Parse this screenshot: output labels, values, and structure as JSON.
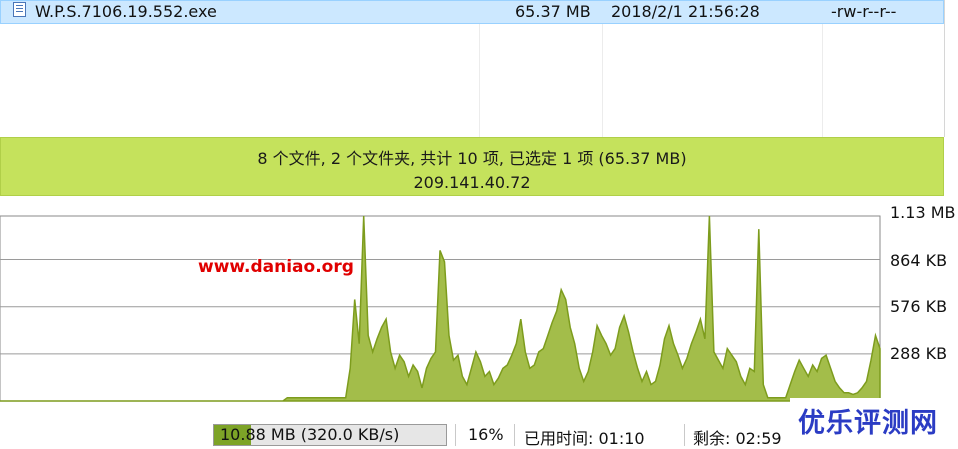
{
  "file_list": {
    "rows": [
      {
        "name": "W.P.S.7106.19.552.exe",
        "size": "65.37 MB",
        "date": "2018/2/1 21:56:28",
        "permissions": "-rw-r--r--",
        "icon": "file-icon"
      }
    ]
  },
  "status": {
    "summary": "8 个文件, 2 个文件夹, 共计 10 项, 已选定 1 项 (65.37 MB)",
    "ip": "209.141.40.72",
    "color": "#c5e25c"
  },
  "graph": {
    "y_labels": [
      "1.13 MB",
      "864 KB",
      "576 KB",
      "288 KB"
    ],
    "fill_color": "#a3bd4a",
    "line_color": "#7d9c1d",
    "chart_data": {
      "type": "area",
      "ylim": [
        0,
        1.13
      ],
      "yunit": "MB",
      "values": [
        0,
        0,
        0,
        0,
        0,
        0,
        0,
        0,
        0,
        0,
        0,
        0,
        0,
        0,
        0,
        0,
        0,
        0,
        0,
        0,
        0,
        0,
        0,
        0,
        0,
        0,
        0,
        0,
        0,
        0,
        0,
        0,
        0,
        0,
        0,
        0,
        0,
        0,
        0,
        0,
        0,
        0,
        0,
        0,
        0,
        0,
        0,
        0,
        0,
        0,
        0,
        0,
        0,
        0,
        0,
        0,
        0,
        0,
        0,
        0,
        0,
        0,
        0,
        0,
        0.02,
        0.02,
        0.02,
        0.02,
        0.02,
        0.02,
        0.02,
        0.02,
        0.02,
        0.02,
        0.02,
        0.02,
        0.02,
        0.02,
        0.2,
        0.62,
        0.35,
        1.13,
        0.4,
        0.3,
        0.38,
        0.45,
        0.5,
        0.3,
        0.2,
        0.28,
        0.24,
        0.15,
        0.22,
        0.18,
        0.08,
        0.2,
        0.26,
        0.3,
        0.92,
        0.85,
        0.4,
        0.25,
        0.28,
        0.15,
        0.1,
        0.2,
        0.3,
        0.24,
        0.15,
        0.18,
        0.1,
        0.14,
        0.2,
        0.22,
        0.28,
        0.35,
        0.5,
        0.3,
        0.2,
        0.22,
        0.3,
        0.32,
        0.4,
        0.48,
        0.55,
        0.68,
        0.62,
        0.45,
        0.35,
        0.2,
        0.12,
        0.18,
        0.3,
        0.46,
        0.4,
        0.35,
        0.28,
        0.32,
        0.45,
        0.52,
        0.42,
        0.3,
        0.2,
        0.12,
        0.18,
        0.1,
        0.12,
        0.22,
        0.38,
        0.46,
        0.35,
        0.28,
        0.2,
        0.26,
        0.35,
        0.42,
        0.5,
        0.38,
        1.13,
        0.3,
        0.25,
        0.2,
        0.32,
        0.28,
        0.24,
        0.15,
        0.1,
        0.2,
        0.18,
        1.05,
        0.1,
        0.02,
        0.02,
        0.02,
        0.02,
        0.02,
        0.1,
        0.18,
        0.25,
        0.2,
        0.15,
        0.22,
        0.18,
        0.26,
        0.28,
        0.2,
        0.12,
        0.08,
        0.05,
        0.05,
        0.04,
        0.05,
        0.08,
        0.12,
        0.25,
        0.4,
        0.32
      ]
    }
  },
  "watermark": "www.daniao.org",
  "brand": "优乐评测网",
  "transfer": {
    "progress_text": "10.88 MB (320.0 KB/s)",
    "progress_fraction": 0.16,
    "percent": "16%",
    "elapsed": "已用时间: 01:10",
    "remaining": "剩余: 02:59"
  }
}
